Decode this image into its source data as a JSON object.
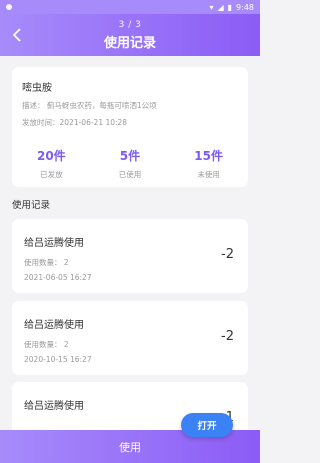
{
  "status_bar": {
    "time": "9:48"
  },
  "header": {
    "pager": "3 / 3",
    "title": "使用记录"
  },
  "info": {
    "name": "嘧虫胺",
    "description": "描述：  蓟马蚜虫农药，每瓶可喷洒1公顷",
    "issue_time": "发放时间：2021-06-21 10:28",
    "stats": [
      {
        "value": "20件",
        "label": "已发放"
      },
      {
        "value": "5件",
        "label": "已使用"
      },
      {
        "value": "15件",
        "label": "未使用"
      }
    ]
  },
  "records_title": "使用记录",
  "records": [
    {
      "title": "给吕运腾使用",
      "qty": "使用数量：  2",
      "date": "2021-06-05 16:27",
      "delta": "-2"
    },
    {
      "title": "给吕运腾使用",
      "qty": "使用数量：  2",
      "date": "2020-10-15 16:27",
      "delta": "-2"
    },
    {
      "title": "给吕运腾使用",
      "qty": "",
      "date": "",
      "delta": "-1"
    }
  ],
  "open_button": "打开",
  "bottom_button": "使用"
}
